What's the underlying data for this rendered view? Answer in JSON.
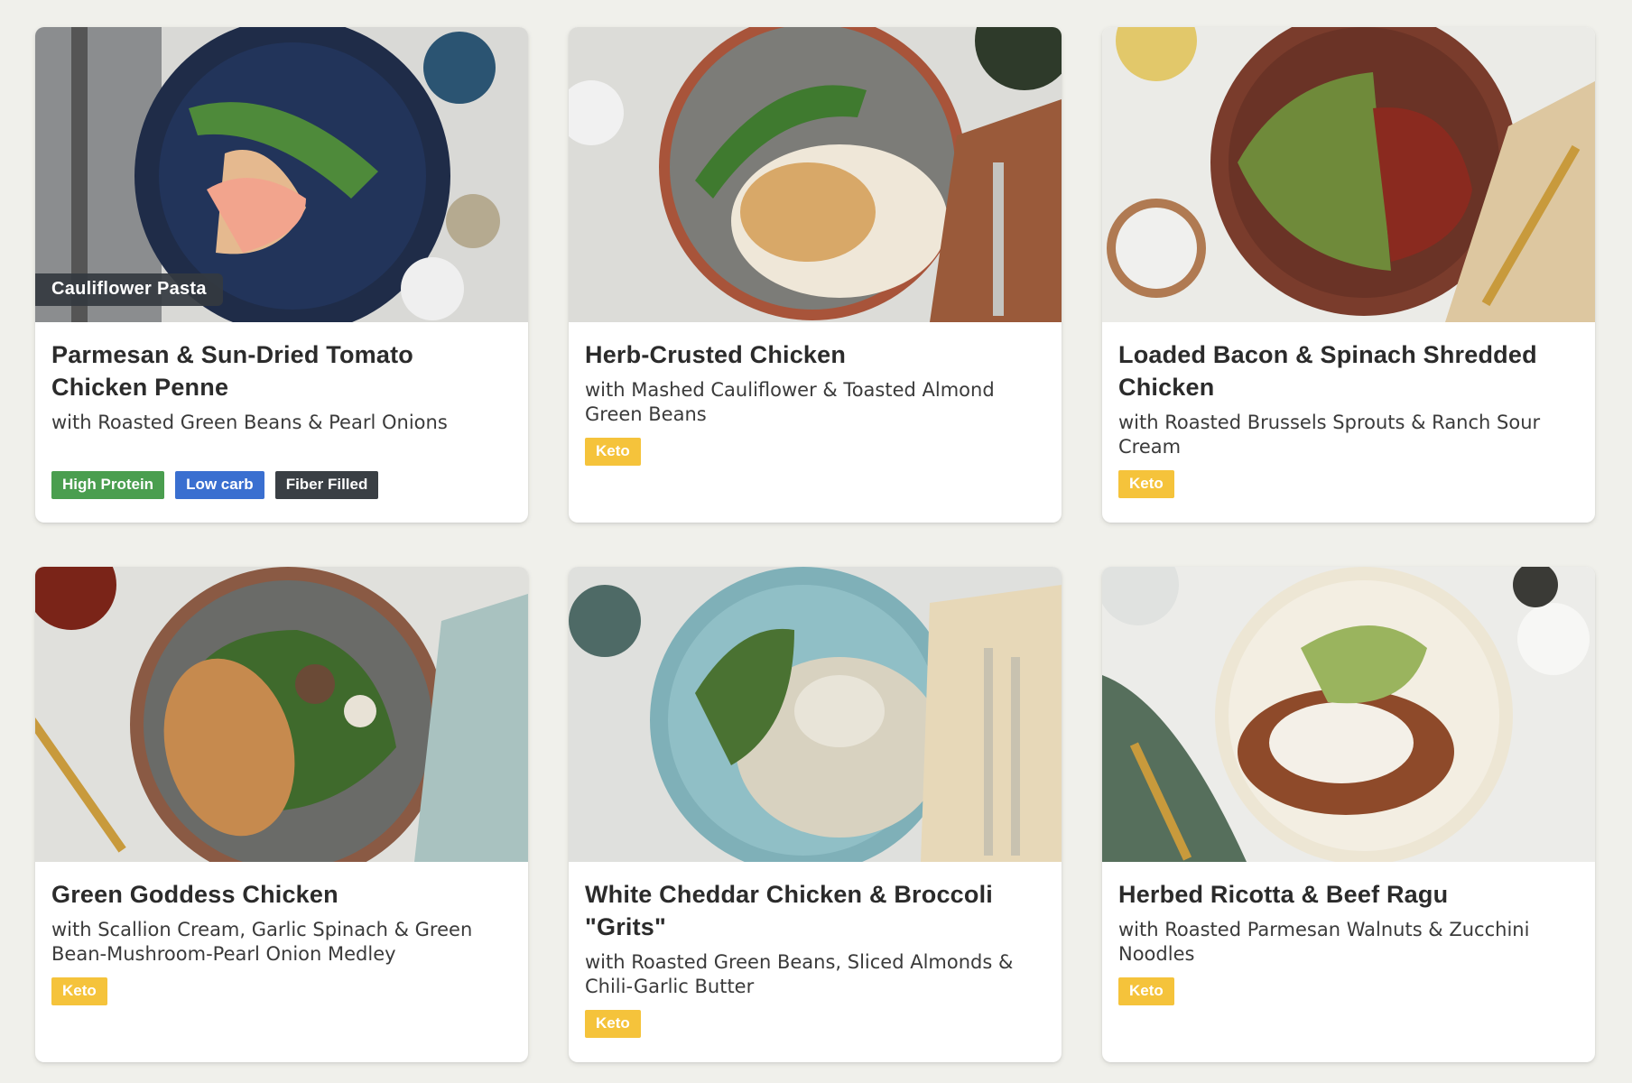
{
  "meals": [
    {
      "image_badge": "Cauliflower Pasta",
      "title": "Parmesan & Sun-Dried Tomato Chicken Penne",
      "subtitle": "with Roasted Green Beans & Pearl Onions",
      "tags": [
        {
          "label": "High Protein",
          "color": "#4a9e4f"
        },
        {
          "label": "Low carb",
          "color": "#3a6fd0"
        },
        {
          "label": "Fiber Filled",
          "color": "#3a3f44"
        }
      ]
    },
    {
      "title": "Herb-Crusted Chicken",
      "subtitle": "with Mashed Cauliflower & Toasted Almond Green Beans",
      "tags": [
        {
          "label": "Keto",
          "color": "#f5c33b"
        }
      ]
    },
    {
      "title": "Loaded Bacon & Spinach Shredded Chicken",
      "subtitle": "with Roasted Brussels Sprouts & Ranch Sour Cream",
      "tags": [
        {
          "label": "Keto",
          "color": "#f5c33b"
        }
      ]
    },
    {
      "title": "Green Goddess Chicken",
      "subtitle": "with Scallion Cream, Garlic Spinach & Green Bean-Mushroom-Pearl Onion Medley",
      "tags": [
        {
          "label": "Keto",
          "color": "#f5c33b"
        }
      ]
    },
    {
      "title": "White Cheddar Chicken & Broccoli \"Grits\"",
      "subtitle": "with Roasted Green Beans, Sliced Almonds & Chili-Garlic Butter",
      "tags": [
        {
          "label": "Keto",
          "color": "#f5c33b"
        }
      ]
    },
    {
      "title": "Herbed Ricotta & Beef Ragu",
      "subtitle": "with Roasted Parmesan Walnuts & Zucchini Noodles",
      "tags": [
        {
          "label": "Keto",
          "color": "#f5c33b"
        }
      ]
    }
  ]
}
